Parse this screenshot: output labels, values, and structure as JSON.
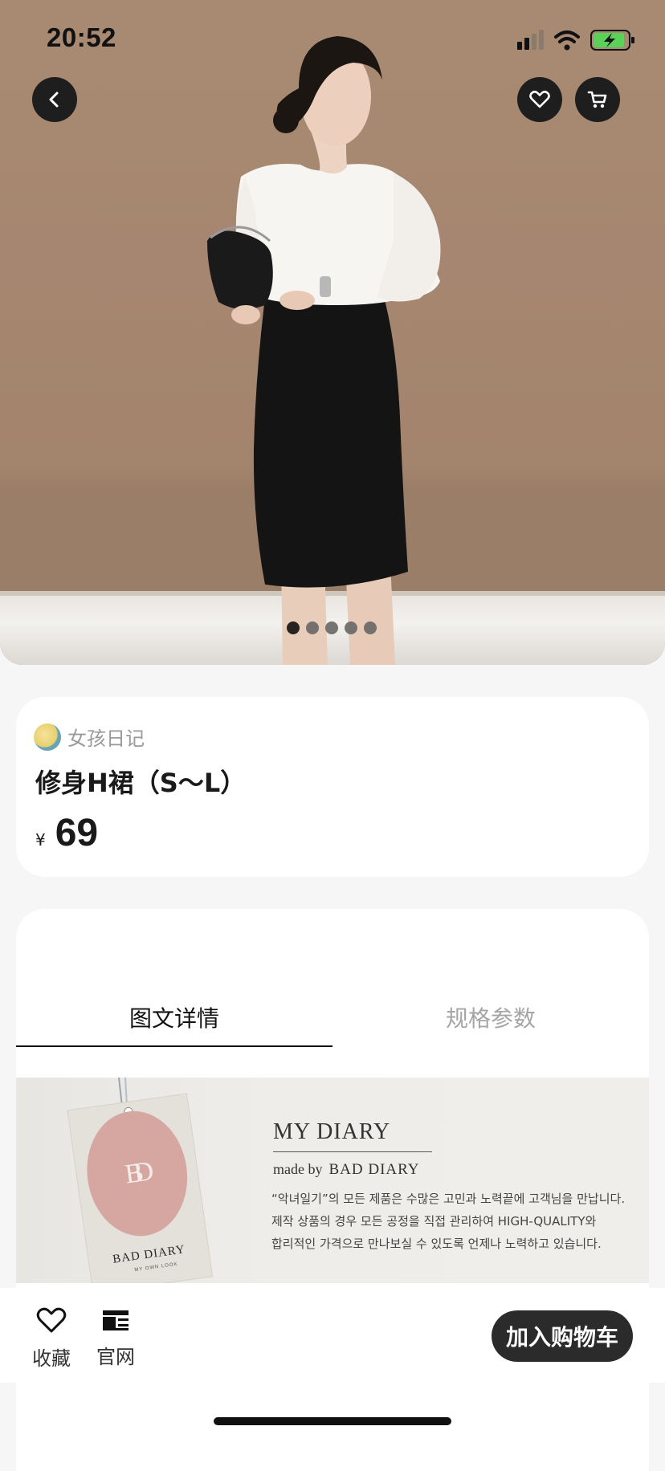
{
  "status_bar": {
    "time": "20:52"
  },
  "hero": {
    "image_alt_icon": "fashion-photo",
    "carousel": {
      "count": 5,
      "active_index": 0
    }
  },
  "header_icons": [
    "back-icon",
    "heart-icon",
    "cart-icon"
  ],
  "product": {
    "shop_name": "女孩日记",
    "title": "修身H裙（S～L）",
    "currency": "¥",
    "price": "69"
  },
  "tabs": [
    {
      "label": "图文详情",
      "active": true
    },
    {
      "label": "规格参数",
      "active": false
    }
  ],
  "banner": {
    "title": "MY DIARY",
    "subtitle_prefix": "made by",
    "subtitle_brand": "BAD DIARY",
    "tag_brand": "BAD DIARY",
    "tag_tagline": "MY OWN LOOK",
    "lines": [
      "“악녀일기”의 모든 제품은 수많은 고민과 노력끝에 고객님을 만납니다.",
      "제작 상품의 경우 모든 공정을 직접 관리하여 HIGH-QUALITY와",
      "합리적인 가격으로 만나보실 수 있도록 언제나 노력하고 있습니다."
    ]
  },
  "bottom_bar": {
    "favorite_label": "收藏",
    "official_site_label": "官网",
    "add_to_cart_label": "加入购物车"
  },
  "colors": {
    "accent_dark": "#2b2b2b",
    "page_bg": "#f6f6f6",
    "muted_text": "#9a9a9a"
  }
}
